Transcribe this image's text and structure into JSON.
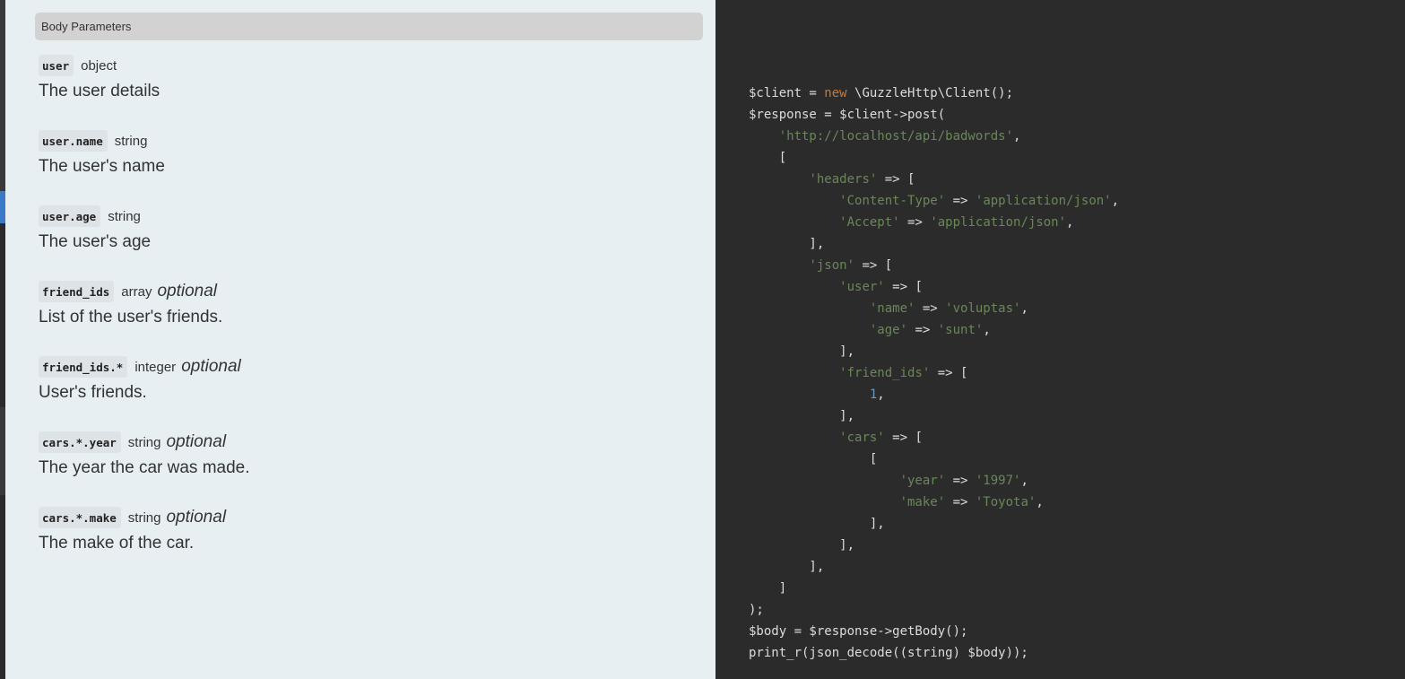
{
  "section_title": "Body Parameters",
  "params": [
    {
      "name": "user",
      "type": "object",
      "optional": "",
      "description": "The user details"
    },
    {
      "name": "user.name",
      "type": "string",
      "optional": "",
      "description": "The user's name"
    },
    {
      "name": "user.age",
      "type": "string",
      "optional": "",
      "description": "The user's age"
    },
    {
      "name": "friend_ids",
      "type": "array",
      "optional": "optional",
      "description": "List of the user's friends."
    },
    {
      "name": "friend_ids.*",
      "type": "integer",
      "optional": "optional",
      "description": "User's friends."
    },
    {
      "name": "cars.*.year",
      "type": "string",
      "optional": "optional",
      "description": "The year the car was made."
    },
    {
      "name": "cars.*.make",
      "type": "string",
      "optional": "optional",
      "description": "The make of the car."
    }
  ],
  "code_lines": [
    [
      [
        "plain",
        "$client = "
      ],
      [
        "kw",
        "new"
      ],
      [
        "plain",
        " \\GuzzleHttp\\Client();"
      ]
    ],
    [
      [
        "plain",
        "$response = $client->post("
      ]
    ],
    [
      [
        "plain",
        "    "
      ],
      [
        "str",
        "'http://localhost/api/badwords'"
      ],
      [
        "plain",
        ","
      ]
    ],
    [
      [
        "plain",
        "    ["
      ]
    ],
    [
      [
        "plain",
        "        "
      ],
      [
        "str",
        "'headers'"
      ],
      [
        "plain",
        " => ["
      ]
    ],
    [
      [
        "plain",
        "            "
      ],
      [
        "str",
        "'Content-Type'"
      ],
      [
        "plain",
        " => "
      ],
      [
        "str",
        "'application/json'"
      ],
      [
        "plain",
        ","
      ]
    ],
    [
      [
        "plain",
        "            "
      ],
      [
        "str",
        "'Accept'"
      ],
      [
        "plain",
        " => "
      ],
      [
        "str",
        "'application/json'"
      ],
      [
        "plain",
        ","
      ]
    ],
    [
      [
        "plain",
        "        ],"
      ]
    ],
    [
      [
        "plain",
        "        "
      ],
      [
        "str",
        "'json'"
      ],
      [
        "plain",
        " => ["
      ]
    ],
    [
      [
        "plain",
        "            "
      ],
      [
        "str",
        "'user'"
      ],
      [
        "plain",
        " => ["
      ]
    ],
    [
      [
        "plain",
        "                "
      ],
      [
        "str",
        "'name'"
      ],
      [
        "plain",
        " => "
      ],
      [
        "str",
        "'voluptas'"
      ],
      [
        "plain",
        ","
      ]
    ],
    [
      [
        "plain",
        "                "
      ],
      [
        "str",
        "'age'"
      ],
      [
        "plain",
        " => "
      ],
      [
        "str",
        "'sunt'"
      ],
      [
        "plain",
        ","
      ]
    ],
    [
      [
        "plain",
        "            ],"
      ]
    ],
    [
      [
        "plain",
        "            "
      ],
      [
        "str",
        "'friend_ids'"
      ],
      [
        "plain",
        " => ["
      ]
    ],
    [
      [
        "plain",
        "                "
      ],
      [
        "num",
        "1"
      ],
      [
        "plain",
        ","
      ]
    ],
    [
      [
        "plain",
        "            ],"
      ]
    ],
    [
      [
        "plain",
        "            "
      ],
      [
        "str",
        "'cars'"
      ],
      [
        "plain",
        " => ["
      ]
    ],
    [
      [
        "plain",
        "                ["
      ]
    ],
    [
      [
        "plain",
        "                    "
      ],
      [
        "str",
        "'year'"
      ],
      [
        "plain",
        " => "
      ],
      [
        "str",
        "'1997'"
      ],
      [
        "plain",
        ","
      ]
    ],
    [
      [
        "plain",
        "                    "
      ],
      [
        "str",
        "'make'"
      ],
      [
        "plain",
        " => "
      ],
      [
        "str",
        "'Toyota'"
      ],
      [
        "plain",
        ","
      ]
    ],
    [
      [
        "plain",
        "                ],"
      ]
    ],
    [
      [
        "plain",
        "            ],"
      ]
    ],
    [
      [
        "plain",
        "        ],"
      ]
    ],
    [
      [
        "plain",
        "    ]"
      ]
    ],
    [
      [
        "plain",
        ");"
      ]
    ],
    [
      [
        "plain",
        "$body = $response->getBody();"
      ]
    ],
    [
      [
        "plain",
        "print_r(json_decode((string) $body));"
      ]
    ]
  ],
  "colors": {
    "content_bg": "#e8eff3",
    "code_bg": "#2b2b2b",
    "keyword": "#cc7832",
    "string": "#6a8759",
    "number": "#6897bb"
  }
}
